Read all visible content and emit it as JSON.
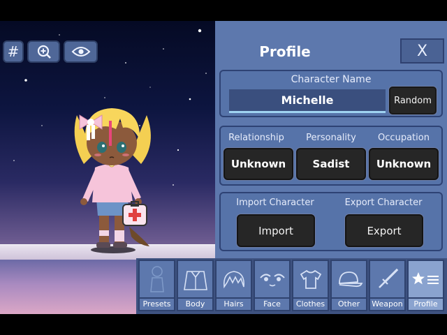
{
  "scene": {
    "toolbar": {
      "grid_label": "#",
      "zoom_icon": "zoom-in-icon",
      "eye_icon": "eye-icon"
    }
  },
  "panel": {
    "title": "Profile",
    "close_label": "X",
    "name_section": {
      "label": "Character Name",
      "value": "Michelle",
      "random_label": "Random"
    },
    "traits": [
      {
        "label": "Relationship",
        "value": "Unknown"
      },
      {
        "label": "Personality",
        "value": "Sadist"
      },
      {
        "label": "Occupation",
        "value": "Unknown"
      }
    ],
    "io": {
      "import_label": "Import Character",
      "import_button": "Import",
      "export_label": "Export Character",
      "export_button": "Export"
    }
  },
  "tabs": [
    {
      "label": "Presets",
      "icon": "person-silhouette-icon"
    },
    {
      "label": "Body",
      "icon": "body-icon"
    },
    {
      "label": "Hairs",
      "icon": "hair-icon"
    },
    {
      "label": "Face",
      "icon": "face-icon"
    },
    {
      "label": "Clothes",
      "icon": "shirt-icon"
    },
    {
      "label": "Other",
      "icon": "cap-icon"
    },
    {
      "label": "Weapon",
      "icon": "sword-icon"
    },
    {
      "label": "Profile",
      "icon": "star-list-icon",
      "active": true
    }
  ],
  "colors": {
    "panel": "#5d78ad",
    "button_dark": "#262626",
    "name_underline": "#9fd3f1"
  }
}
